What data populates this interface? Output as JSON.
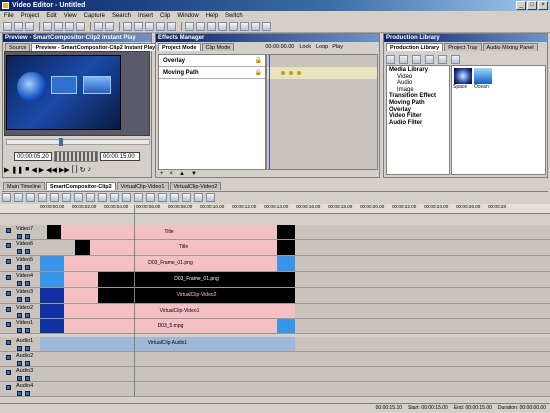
{
  "window": {
    "title": "Video Editor - Untitled",
    "controls": [
      "_",
      "□",
      "×"
    ]
  },
  "menu": [
    "File",
    "Project",
    "Edit",
    "View",
    "Capture",
    "Search",
    "Insert",
    "Clip",
    "Window",
    "Help",
    "Switch"
  ],
  "preview_panel": {
    "title": "Preview - SmartCompositor-Clip2 Instant Play",
    "tabs": [
      "Source",
      "Preview - SmartCompositor-Clip2 Instant Play"
    ],
    "timecode_current": "00:00:05.20",
    "timecode_total": "00:00:15.00"
  },
  "effects_panel": {
    "title": "Effects Manager",
    "tabs": [
      "Project Mode",
      "Clip Mode"
    ],
    "timecode": "00:00:00.00",
    "lock_label": "Lock",
    "loop_label": "Loop",
    "play_label": "Play",
    "effects": [
      "Overlay",
      "Moving Path"
    ]
  },
  "library_panel": {
    "title": "Production Library",
    "tabs": [
      "Production Library",
      "Project Tray",
      "Audio Mixing Panel"
    ],
    "tree": [
      "Media Library",
      "Video",
      "Audio",
      "Image",
      "Transition Effect",
      "Moving Path",
      "Overlay",
      "Video Filter",
      "Audio Filter"
    ],
    "thumbs": [
      "Space",
      "Ocean"
    ]
  },
  "timeline_tabs": [
    "Main Timeline",
    "SmartCompositor-Clip2",
    "VirtualClip-Video1",
    "VirtualClip-Video2"
  ],
  "ruler": [
    "00:00:00.00",
    "00:00:02.00",
    "00:00:04.00",
    "00:00:06.00",
    "00:00:08.00",
    "00:00:10.00",
    "00:00:12.00",
    "00:00:14.00",
    "00:00:16.00",
    "00:00:18.00",
    "00:00:20.00",
    "00:00:22.00",
    "00:00:24.00",
    "00:00:26.00",
    "00:00:28"
  ],
  "video_tracks": [
    {
      "name": "Video7",
      "clip": "Title"
    },
    {
      "name": "Video6",
      "clip": "Title"
    },
    {
      "name": "Video5",
      "clip": "D03_Frame_01.png"
    },
    {
      "name": "Video4",
      "clip": "D03_Frame_01.png"
    },
    {
      "name": "Video3",
      "clip": "VirtualClip-Video2"
    },
    {
      "name": "Video2",
      "clip": "VirtualClip-Video1"
    },
    {
      "name": "Video1",
      "clip": "D03_5.mpg"
    }
  ],
  "audio_tracks": [
    {
      "name": "Audio1",
      "clip": "VirtualClip Audio1"
    },
    {
      "name": "Audio2",
      "clip": ""
    },
    {
      "name": "Audio3",
      "clip": ""
    },
    {
      "name": "Audio4",
      "clip": ""
    }
  ],
  "status": {
    "position": "00:00:15.10",
    "start": "Start: 00:00:15.00",
    "end": "End: 00:00:15.00",
    "duration": "Duration: 00:00:00.00"
  },
  "colors": {
    "clip_pink": "#f4c0c4",
    "clip_black": "#000000",
    "clip_blue": "#3a96e8",
    "audio_blue": "#9fb8d8",
    "title_blue": "#0a246a"
  }
}
